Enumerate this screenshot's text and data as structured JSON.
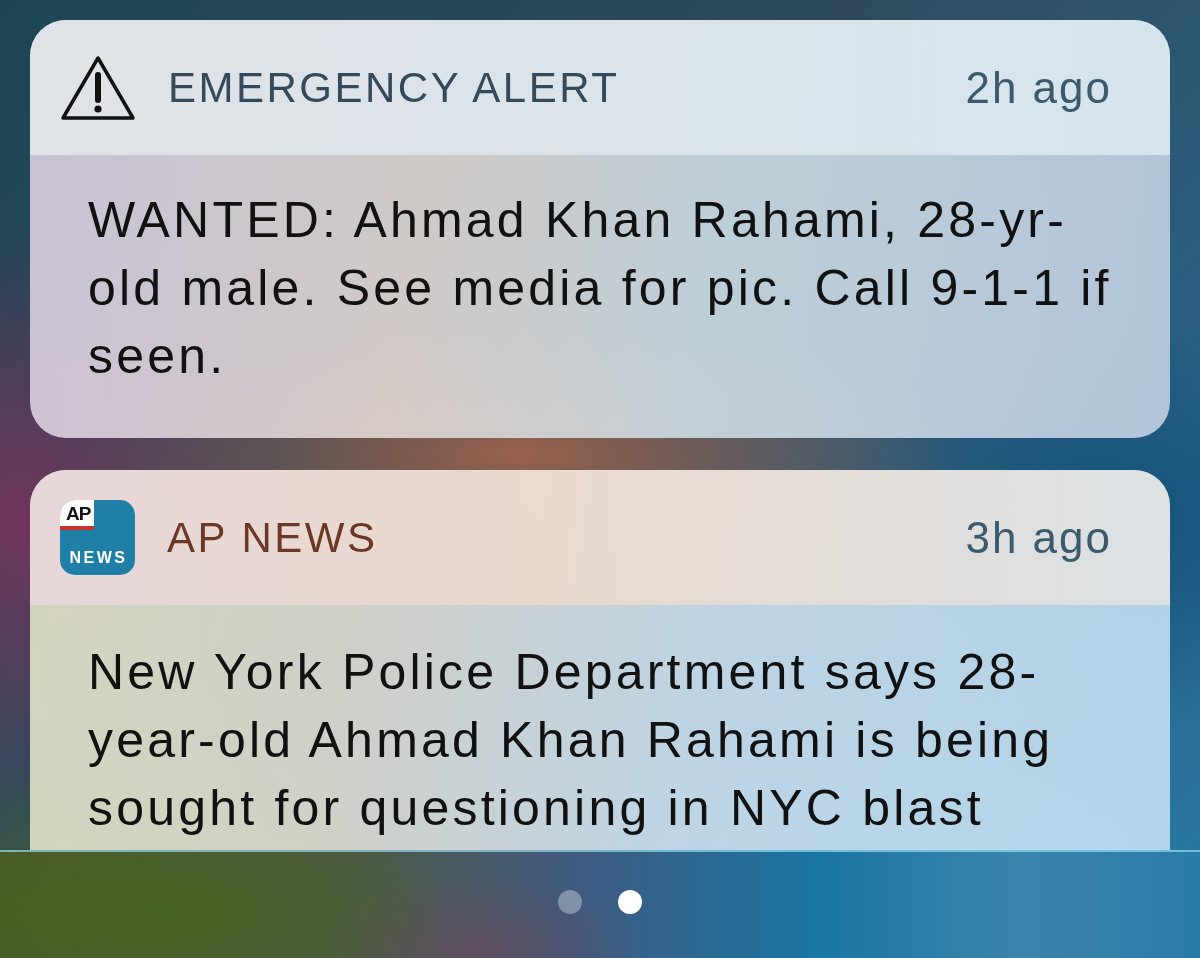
{
  "notifications": [
    {
      "kind": "alert",
      "app": "EMERGENCY ALERT",
      "time": "2h ago",
      "body": "WANTED: Ahmad Khan Rahami, 28-yr-old male. See media for pic. Call 9-1-1 if seen."
    },
    {
      "kind": "app",
      "app": "AP NEWS",
      "icon_text": [
        "AP",
        "NEWS"
      ],
      "time": "3h ago",
      "body": "New York Police Department says 28-year-old Ahmad Khan Rahami is being sought for questioning in NYC blast"
    }
  ],
  "page_dots": [
    {
      "selected": false
    },
    {
      "selected": true
    }
  ]
}
